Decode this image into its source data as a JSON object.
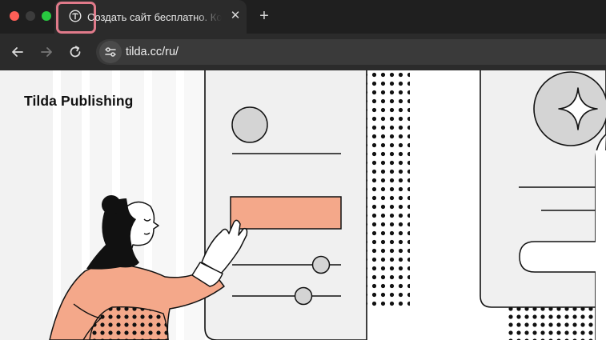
{
  "browser": {
    "tab": {
      "title": "Создать сайт бесплатно. Ко",
      "favicon": "tilda-logo-icon",
      "close_symbol": "✕"
    },
    "new_tab_symbol": "+",
    "address_bar": {
      "url": "tilda.cc/ru/"
    },
    "icons": [
      "back-icon",
      "forward-icon",
      "reload-icon",
      "site-info-icon"
    ]
  },
  "page": {
    "brand": "Tilda Publishing"
  },
  "colors": {
    "accent_salmon": "#f4a88a",
    "ink": "#111111",
    "panel_gray": "#f0f0f0",
    "highlight_frame": "#e07a8a"
  }
}
